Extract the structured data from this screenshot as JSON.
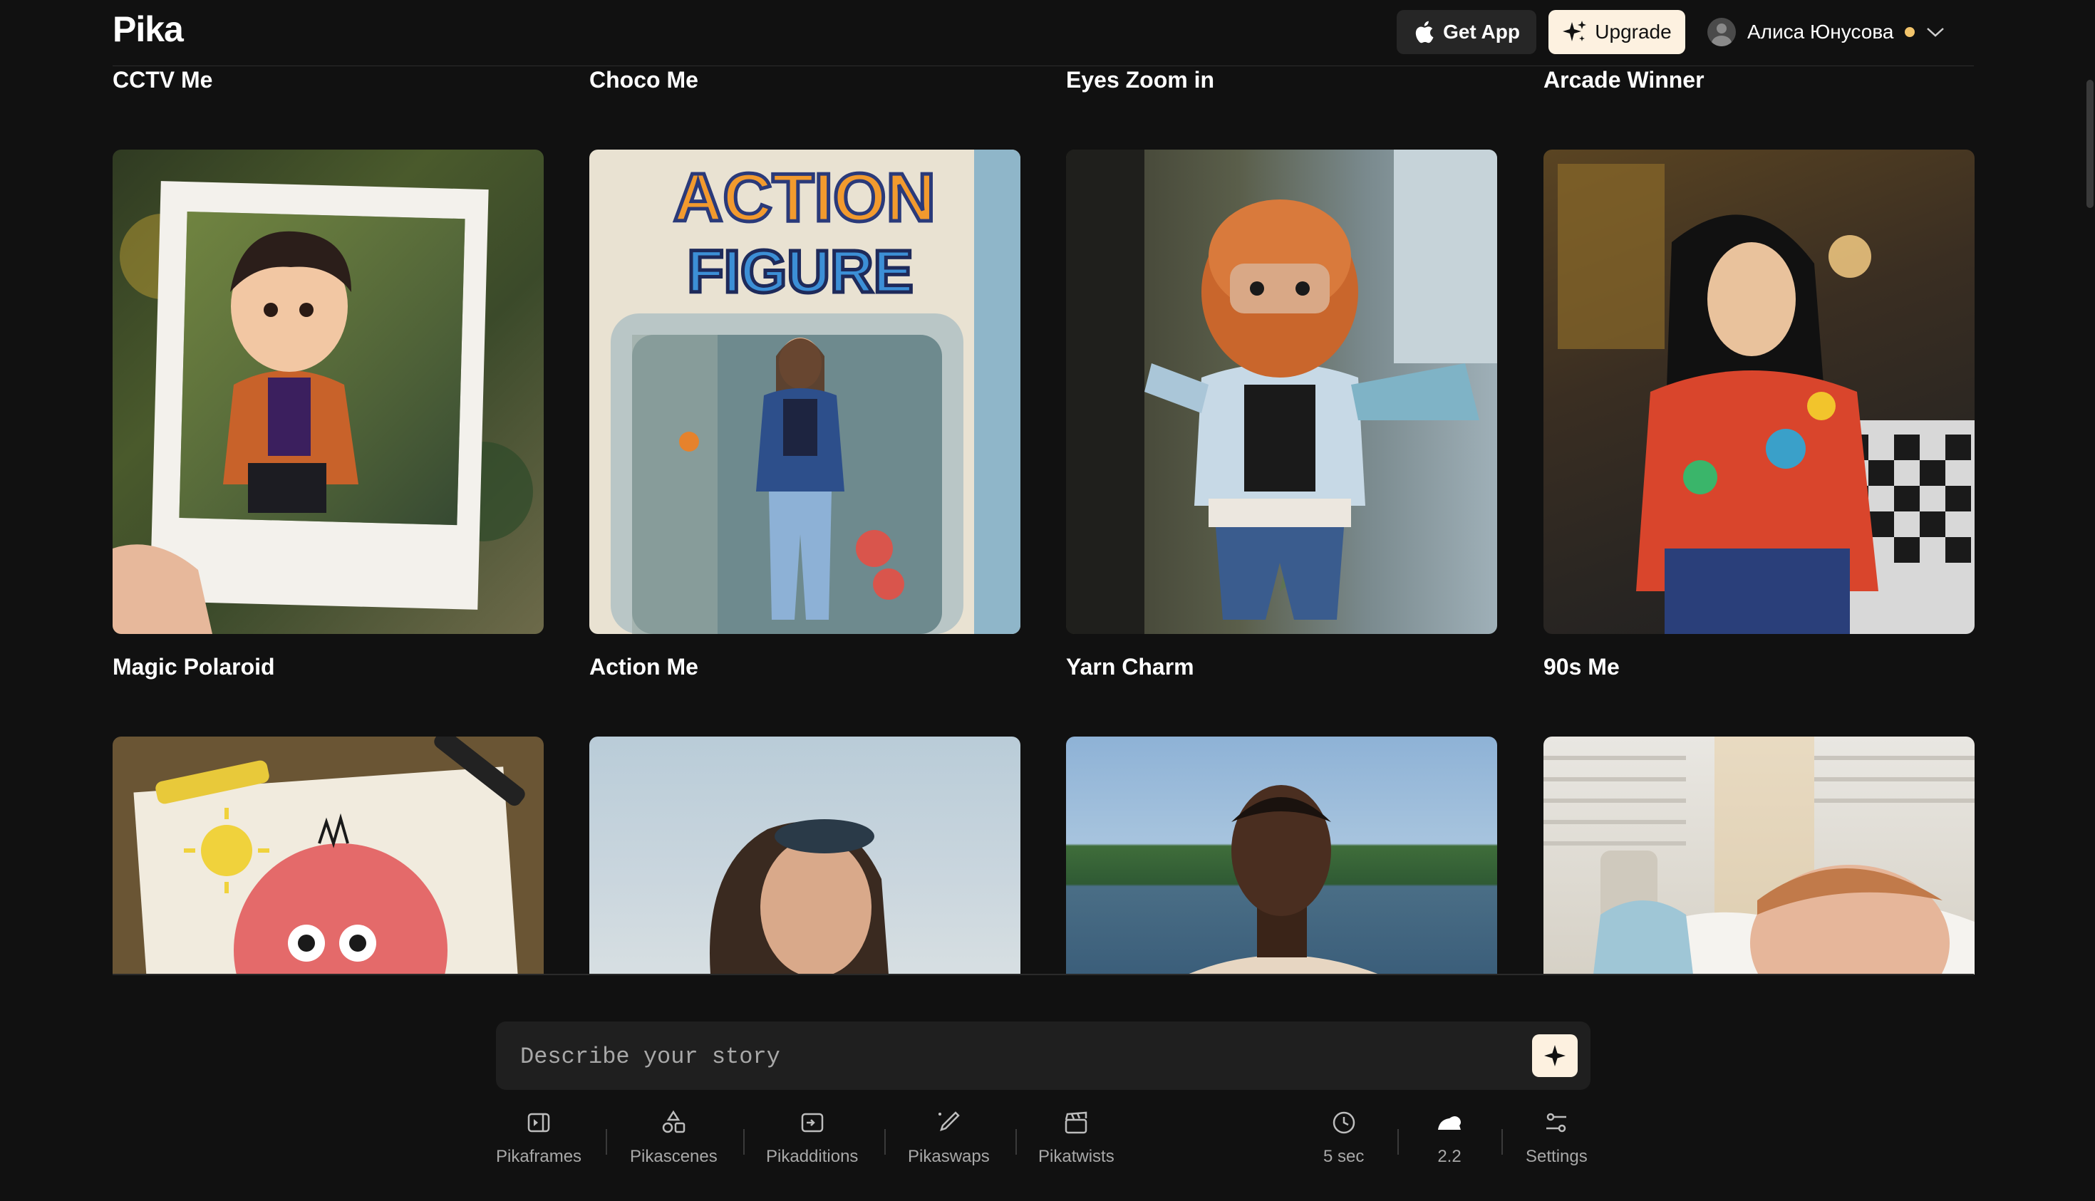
{
  "header": {
    "logo": "Pika",
    "get_app_label": "Get App",
    "upgrade_label": "Upgrade",
    "user_name": "Алиса Юнусова"
  },
  "gallery": {
    "top_row_labels": [
      "CCTV Me",
      "Choco Me",
      "Eyes Zoom in",
      "Arcade Winner"
    ],
    "cards": [
      {
        "label": "Magic Polaroid"
      },
      {
        "label": "Action Me",
        "image_text_1": "ACTION",
        "image_text_2": "FIGURE"
      },
      {
        "label": "Yarn Charm"
      },
      {
        "label": "90s Me"
      }
    ]
  },
  "prompt": {
    "placeholder": "Describe your story"
  },
  "toolbar": {
    "items": [
      {
        "label": "Pikaframes",
        "icon": "frames-icon"
      },
      {
        "label": "Pikascenes",
        "icon": "shapes-icon"
      },
      {
        "label": "Pikadditions",
        "icon": "add-in-icon"
      },
      {
        "label": "Pikaswaps",
        "icon": "brush-icon"
      },
      {
        "label": "Pikatwists",
        "icon": "clapper-icon"
      }
    ],
    "duration": "5 sec",
    "model": "2.2",
    "settings": "Settings"
  },
  "colors": {
    "background": "#111111",
    "upgrade_bg": "#fdf1e0",
    "get_app_bg": "#262626",
    "status_dot": "#f2c46b",
    "muted_text": "#a8a8a8"
  }
}
